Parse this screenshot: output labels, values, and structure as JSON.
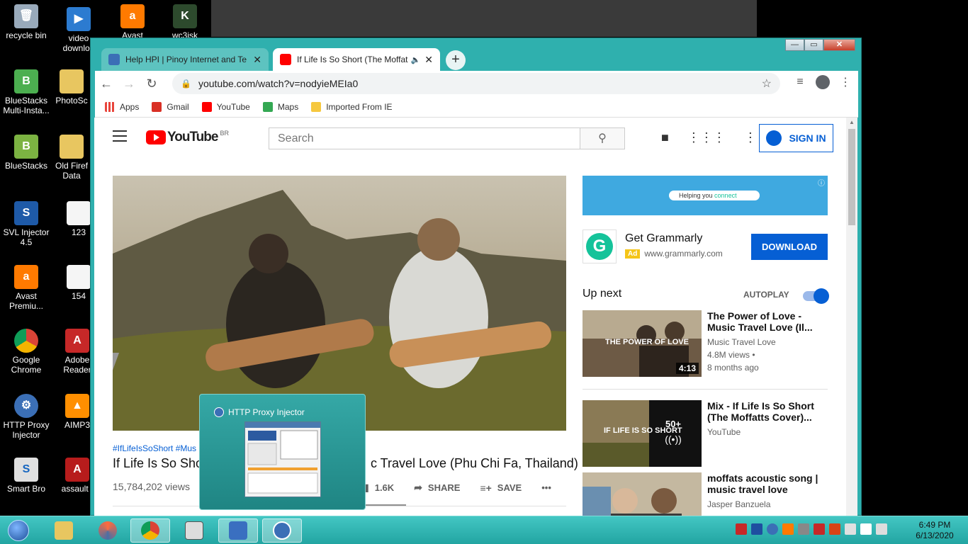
{
  "desktop": {
    "icons": [
      {
        "label": "recycle bin",
        "icon": "recycle-bin-icon"
      },
      {
        "label": "video downloa",
        "icon": "video-downloader-icon"
      },
      {
        "label": "Avast",
        "icon": "avast-icon"
      },
      {
        "label": "wc3isk",
        "icon": "wc3isk-icon"
      },
      {
        "label": "BlueStacks Multi-Insta...",
        "icon": "bluestacks-multi-icon"
      },
      {
        "label": "PhotoSc",
        "icon": "folder-icon"
      },
      {
        "label": "BlueStacks",
        "icon": "bluestacks-icon"
      },
      {
        "label": "Old Firef Data",
        "icon": "folder-icon"
      },
      {
        "label": "SVL Injector 4.5",
        "icon": "svl-injector-icon"
      },
      {
        "label": "123",
        "icon": "text-file-icon"
      },
      {
        "label": "Avast Premiu...",
        "icon": "avast-icon"
      },
      {
        "label": "154",
        "icon": "text-file-icon"
      },
      {
        "label": "Google Chrome",
        "icon": "chrome-icon"
      },
      {
        "label": "Adobe Reader",
        "icon": "adobe-reader-icon"
      },
      {
        "label": "HTTP Proxy Injector",
        "icon": "http-proxy-injector-icon"
      },
      {
        "label": "AIMP3",
        "icon": "aimp-icon"
      },
      {
        "label": "Smart Bro",
        "icon": "smart-bro-icon"
      },
      {
        "label": "assault f",
        "icon": "assault-icon"
      }
    ]
  },
  "browser": {
    "window_controls": {
      "minimize": "—",
      "maximize": "▭",
      "close": "✕"
    },
    "tabs": [
      {
        "title": "Help HPI | Pinoy Internet and Te",
        "close": "✕"
      },
      {
        "title": "If Life Is So Short (The Moffat",
        "close": "✕"
      }
    ],
    "new_tab": "+",
    "url": "youtube.com/watch?v=nodyieMEIa0",
    "bookmarks": [
      {
        "label": "Apps",
        "color": "#e8453c"
      },
      {
        "label": "Gmail",
        "color": "#d93025"
      },
      {
        "label": "YouTube",
        "color": "#ff0000"
      },
      {
        "label": "Maps",
        "color": "#34a853"
      },
      {
        "label": "Imported From IE",
        "color": "#f6c83f"
      }
    ]
  },
  "youtube": {
    "logo_text": "YouTube",
    "logo_region": "BR",
    "search_placeholder": "Search",
    "sign_in": "SIGN IN",
    "video": {
      "hashtags": "#IfLifeIsSoShort #Mus",
      "title_left": "If Life Is So Sho",
      "title_right": "c Travel Love (Phu Chi Fa, Thailand)",
      "views": "15,784,202 views",
      "likes": "1.6K",
      "share": "SHARE",
      "save": "SAVE",
      "more": "•••"
    },
    "ad": {
      "banner_text_1": "Helping you ",
      "banner_text_2": "connect",
      "title": "Get Grammarly",
      "badge": "Ad",
      "domain": "www.grammarly.com",
      "cta": "DOWNLOAD"
    },
    "up_next": "Up next",
    "autoplay": "AUTOPLAY",
    "recommendations": [
      {
        "title": "The Power of Love - Music Travel Love (Il...",
        "channel": "Music Travel Love",
        "views": "4.8M views •",
        "age": "8 months ago",
        "duration": "4:13",
        "thumb_text": "THE POWER OF LOVE"
      },
      {
        "title": "Mix - If Life Is So Short (The Moffatts Cover)...",
        "channel": "YouTube",
        "views": "",
        "age": "",
        "duration": "50+",
        "thumb_text": "IF LIFE IS SO SHORT"
      },
      {
        "title": "moffats acoustic song | music travel love",
        "channel": "Jasper Banzuela",
        "views": "",
        "age": "",
        "duration": "",
        "thumb_text": ""
      }
    ]
  },
  "preview": {
    "title": "HTTP Proxy Injector"
  },
  "taskbar": {
    "time": "6:49 PM",
    "date": "6/13/2020"
  }
}
